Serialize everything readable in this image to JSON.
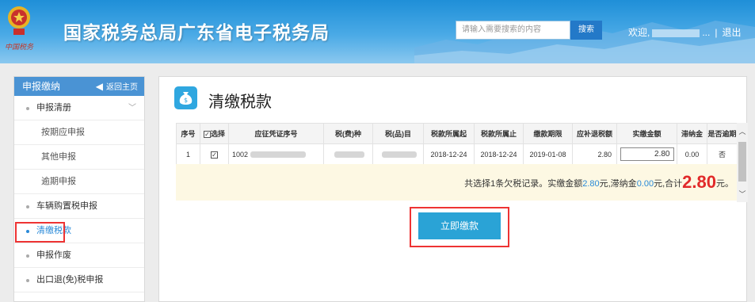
{
  "header": {
    "title": "国家税务总局广东省电子税务局",
    "emblem_caption": "中国税务",
    "search_placeholder": "请输入需要搜索的内容",
    "search_button": "搜索",
    "welcome": "欢迎,",
    "welcome_suffix": "...",
    "separator": "|",
    "logout": "退出"
  },
  "sidebar": {
    "header": "申报缴纳",
    "back": "返回主页",
    "items": [
      {
        "label": "申报清册",
        "level": 1,
        "expanded": true
      },
      {
        "label": "按期应申报",
        "level": 2
      },
      {
        "label": "其他申报",
        "level": 2
      },
      {
        "label": "逾期申报",
        "level": 2
      },
      {
        "label": "车辆购置税申报",
        "level": 1
      },
      {
        "label": "清缴税款",
        "level": 1,
        "active": true
      },
      {
        "label": "申报作废",
        "level": 1
      },
      {
        "label": "出口退(免)税申报",
        "level": 1
      }
    ]
  },
  "main": {
    "title": "清缴税款",
    "columns": [
      "序号",
      "选择",
      "应征凭证序号",
      "税(费)种",
      "税(品)目",
      "税款所属起",
      "税款所属止",
      "缴款期限",
      "应补退税额",
      "实缴金额",
      "滞纳金",
      "是否逾期"
    ],
    "rows": [
      {
        "index": "1",
        "checked": true,
        "voucher_no": "1002",
        "tax_type": "",
        "tax_item": "",
        "period_start": "2018-12-24",
        "period_end": "2018-12-24",
        "deadline": "2019-01-08",
        "amount_due": "2.80",
        "paid_amount": "2.80",
        "late_fee": "0.00",
        "overdue": "否"
      }
    ],
    "summary": {
      "prefix": "共选择1条欠税记录。实缴金额",
      "paid": "2.80",
      "mid1": "元,滞纳金",
      "late": "0.00",
      "mid2": "元,合计",
      "total": "2.80",
      "suffix": "元。"
    },
    "pay_button": "立即缴款"
  },
  "colors": {
    "header_blue": "#1f8fd8",
    "sidebar_header": "#4a93d4",
    "pay_button": "#2aa3d6",
    "highlight_red": "#e33333",
    "total_red": "#e12a2a"
  }
}
